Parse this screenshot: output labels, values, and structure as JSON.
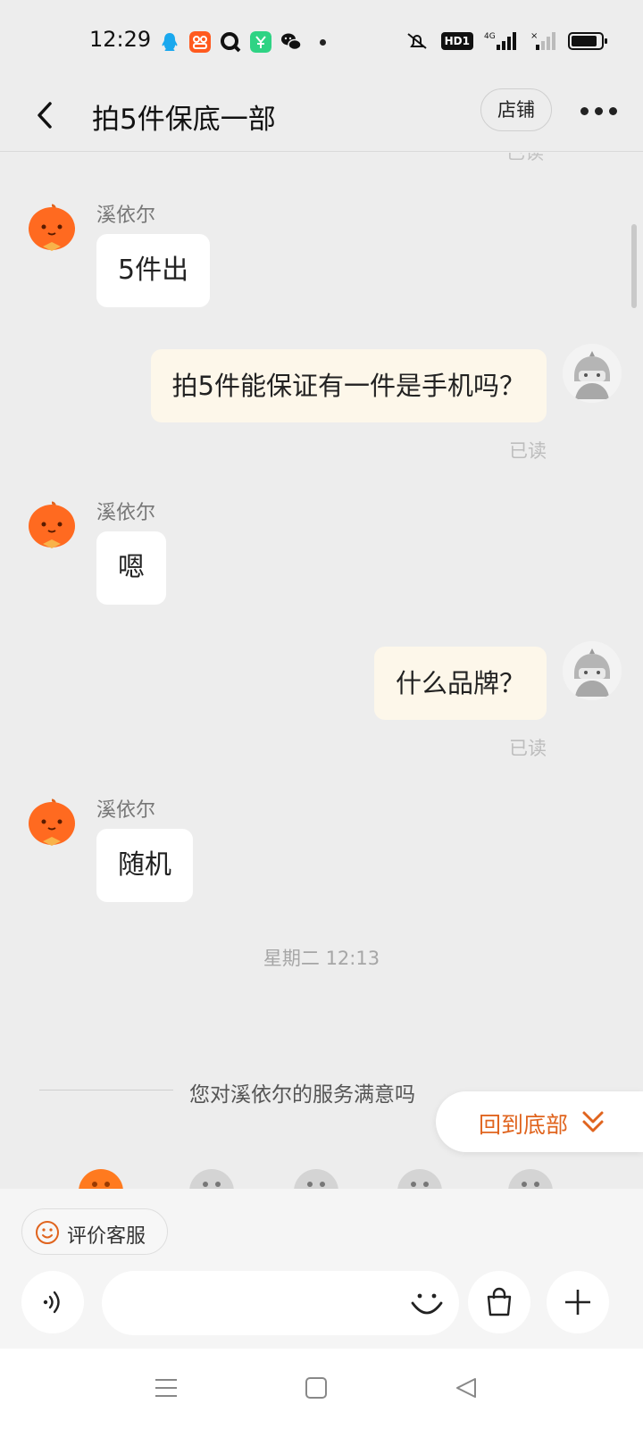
{
  "status_bar": {
    "time": "12:29",
    "hd_label": "HD1",
    "network_label": "4G",
    "app_icons": [
      "qq-icon",
      "app-orange-icon",
      "browser-icon",
      "app-green-icon",
      "wechat-icon"
    ]
  },
  "header": {
    "title": "拍5件保底一部",
    "shop_label": "店铺"
  },
  "chat": {
    "top_read": "已读",
    "messages": [
      {
        "from": "shop",
        "sender": "溪依尔",
        "text": "5件出"
      },
      {
        "from": "user",
        "text": "拍5件能保证有一件是手机吗？",
        "status": "已读"
      },
      {
        "from": "shop",
        "sender": "溪依尔",
        "text": "嗯"
      },
      {
        "from": "user",
        "text": "什么品牌？",
        "status": "已读"
      },
      {
        "from": "shop",
        "sender": "溪依尔",
        "text": "随机"
      }
    ],
    "timestamp": "星期二 12:13",
    "survey_prompt": "您对溪依尔的服务满意吗",
    "back_to_bottom": "回到底部"
  },
  "input_panel": {
    "rate_label": "评价客服",
    "input_value": "",
    "input_placeholder": ""
  },
  "colors": {
    "accent": "#e0641e",
    "background": "#ededed",
    "bubble_in": "#ffffff",
    "bubble_out": "#fdf7ea"
  }
}
